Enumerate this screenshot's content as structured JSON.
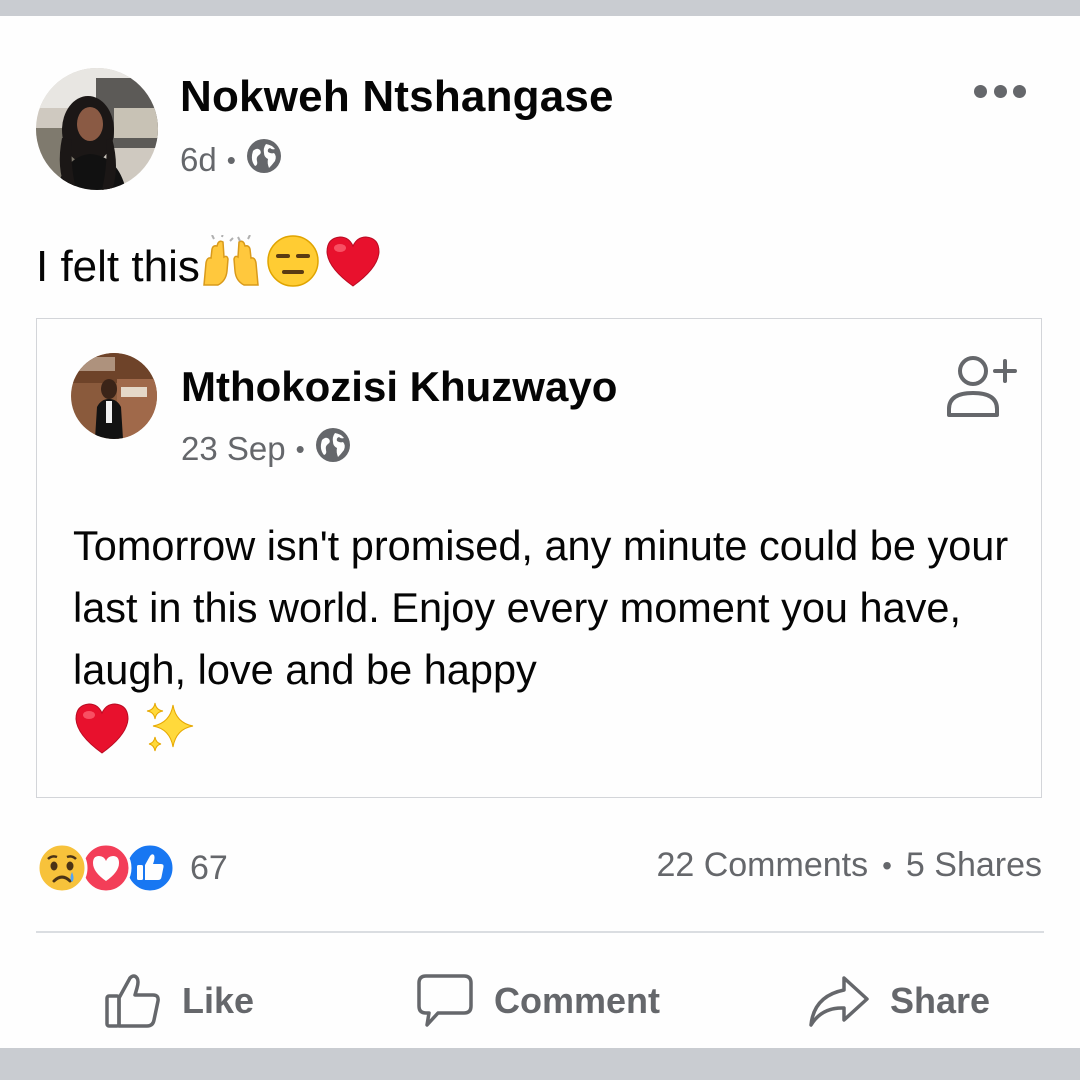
{
  "post": {
    "author": "Nokweh Ntshangase",
    "time": "6d",
    "separator": "•",
    "privacy_icon": "globe-icon",
    "text": "I felt this",
    "text_emojis": [
      "raising-hands",
      "expressionless-face",
      "red-heart"
    ]
  },
  "shared_post": {
    "author": "Mthokozisi Khuzwayo",
    "time": "23 Sep",
    "separator": "•",
    "privacy_icon": "globe-icon",
    "text": "Tomorrow isn't promised, any minute could be your last in this world. Enjoy every moment you have, laugh, love and be happy",
    "text_emojis": [
      "red-heart",
      "sparkles"
    ],
    "action_icon": "add-friend-icon"
  },
  "engagement": {
    "reaction_icons": [
      "sad-reaction",
      "love-reaction",
      "like-reaction"
    ],
    "reaction_count": "67",
    "comments": "22 Comments",
    "separator": "•",
    "shares": "5 Shares"
  },
  "actions": {
    "like": "Like",
    "comment": "Comment",
    "share": "Share"
  },
  "colors": {
    "secondary_text": "#65676b",
    "like_blue": "#1877f2",
    "love_red": "#f33e58",
    "page_bg": "#c9ccd1"
  }
}
